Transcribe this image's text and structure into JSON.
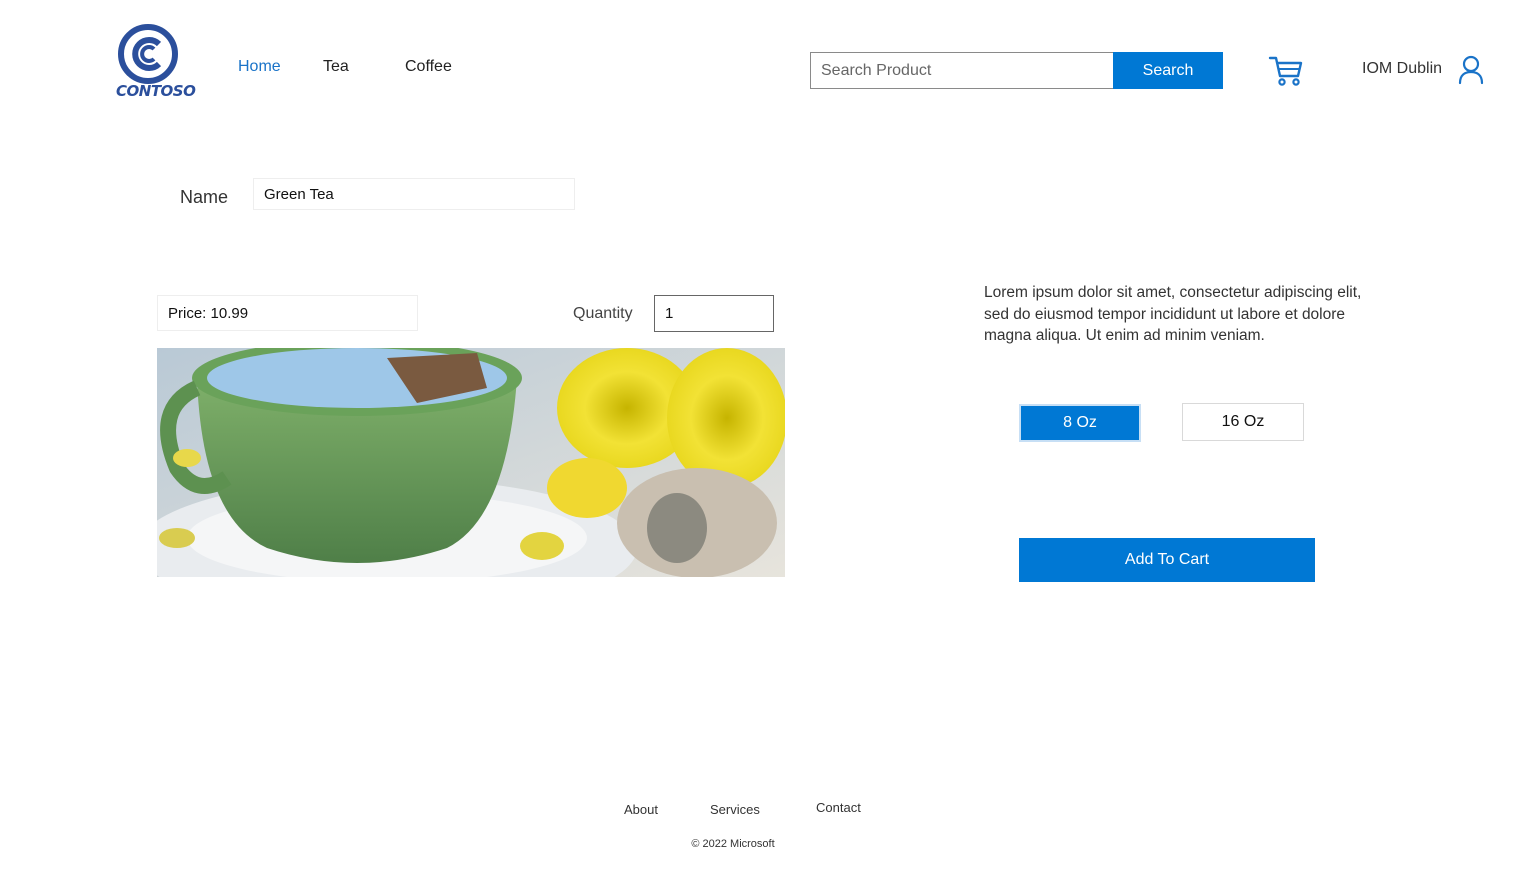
{
  "brand": {
    "name": "CONTOSO",
    "logo_icon": "contoso-c-logo",
    "color": "#2b4f9c"
  },
  "nav": {
    "items": [
      {
        "label": "Home",
        "active": true
      },
      {
        "label": "Tea",
        "active": false
      },
      {
        "label": "Coffee",
        "active": false
      }
    ],
    "active_color": "#1a73c8"
  },
  "search": {
    "placeholder": "Search Product",
    "value": "",
    "button_label": "Search"
  },
  "cart": {
    "icon": "shopping-cart-icon"
  },
  "user": {
    "label": "IOM Dublin",
    "icon": "user-icon"
  },
  "product": {
    "name_label": "Name",
    "name_value": "Green Tea",
    "price_text": "Price: 10.99",
    "quantity_label": "Quantity",
    "quantity_value": "1",
    "image": "green teacup on saucer with yellow flowers",
    "description": "Lorem ipsum dolor sit amet, consectetur adipiscing elit, sed do eiusmod tempor incididunt ut labore et dolore magna aliqua. Ut enim ad minim veniam.",
    "sizes": [
      {
        "label": "8 Oz",
        "selected": true
      },
      {
        "label": "16 Oz",
        "selected": false
      }
    ],
    "add_to_cart_label": "Add To Cart"
  },
  "footer": {
    "links": [
      "About",
      "Services",
      "Contact"
    ],
    "copyright": "© 2022 Microsoft"
  },
  "colors": {
    "accent": "#0078d4"
  }
}
